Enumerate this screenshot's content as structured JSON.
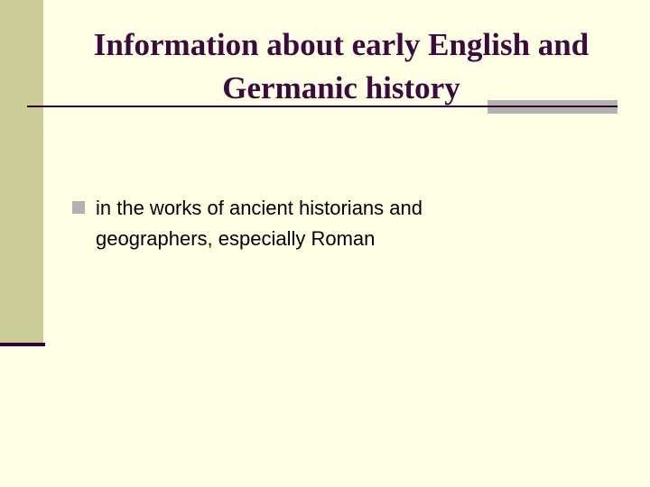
{
  "slide": {
    "title": {
      "line1": "Information about early English and",
      "line2": "Germanic history"
    },
    "bullets": [
      {
        "icon": "square-bullet",
        "line1": "in the works of ancient historians and",
        "line2": "geographers, especially Roman"
      }
    ]
  },
  "colors": {
    "background": "#FFFFE5",
    "left_band": "#CCCC99",
    "title_text": "#3D0A3D",
    "rule": "#330033",
    "accent_bar": "#B2B2B2",
    "bullet": "#B2B2B2",
    "body_text": "#000000"
  }
}
